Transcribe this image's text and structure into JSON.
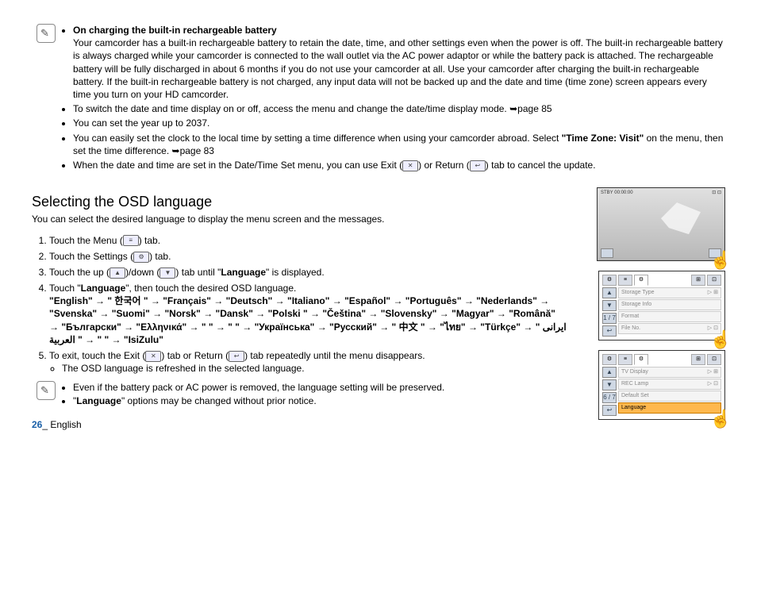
{
  "note1": {
    "h": "On charging the built-in rechargeable battery",
    "p1": "Your camcorder has a built-in rechargeable battery to retain the date, time, and other settings even when the power is off. The built-in rechargeable battery is always charged while your camcorder is connected to the wall outlet via the AC power adaptor or while the battery pack is attached. The rechargeable battery will be fully discharged in about 6 months if you do not use your camcorder at all. Use your camcorder after charging the built-in rechargeable battery. If the built-in rechargeable battery is not charged, any input data will not be backed up and the date and time (time zone) screen appears every time you turn on your HD camcorder.",
    "b2_a": "To switch the date and time display on or off, access the menu and change the date/time display mode. ",
    "b2_b": "page 85",
    "b3": "You can set the year up to 2037.",
    "b4_a": "You can easily set the clock to the local time by setting a time difference when using your camcorder abroad. Select ",
    "b4_b": "\"Time Zone: Visit\"",
    "b4_c": " on the menu, then set the time difference. ",
    "b4_d": "page 83",
    "b5_a": "When the date and time are set in the Date/Time Set menu, you can use Exit (",
    "b5_b": ") or Return (",
    "b5_c": ") tab to cancel the update."
  },
  "section": {
    "title": "Selecting the OSD language",
    "intro": "You can select the desired language to display the menu screen and the messages.",
    "s1_a": "Touch the Menu (",
    "s1_b": ") tab.",
    "s2_a": "Touch the Settings (",
    "s2_b": ") tab.",
    "s3_a": "Touch the up (",
    "s3_b": ")/down (",
    "s3_c": ") tab until \"",
    "s3_d": "Language",
    "s3_e": "\" is displayed.",
    "s4_a": "Touch \"",
    "s4_b": "Language",
    "s4_c": "\", then touch the desired OSD language.",
    "langs": "\"English\" → \" 한국어 \" → \"Français\" → \"Deutsch\" → \"Italiano\" → \"Español\" → \"Português\" → \"Nederlands\" → \"Svenska\" → \"Suomi\" → \"Norsk\" → \"Dansk\" → \"Polski \" → \"Čeština\" → \"Slovensky\" → \"Magyar\" → \"Română\" → \"Български\" → \"Ελληνικά\" → \"          \" → \"          \" → \"Українська\" → \"Русский\" → \" 中文 \" → \"ไทย\" → \"Türkçe\" → \" ايرانى \" → \" العربية \" → \"IsiZulu\"",
    "s5_a": "To exit, touch the Exit (",
    "s5_b": ") tab or Return (",
    "s5_c": ") tab repeatedly until the menu disappears.",
    "s5_sub": "The OSD language is refreshed in the selected language."
  },
  "note2": {
    "b1": "Even if the battery pack or AC power is removed, the language setting will be preserved.",
    "b2_a": "\"",
    "b2_b": "Language",
    "b2_c": "\" options may be changed without prior notice."
  },
  "icons": {
    "menu": "≡",
    "settings": "⚙",
    "exit": "✕",
    "return": "↩",
    "up": "▲",
    "down": "▼",
    "arrow": "➥"
  },
  "screens": {
    "s1_top": "STBY 00:00:00",
    "s2": {
      "pg": "1 / 7",
      "r1": "Storage Type",
      "r2": "Storage Info",
      "r3": "Format",
      "r4": "File No."
    },
    "s3": {
      "pg": "6 / 7",
      "r1": "TV Display",
      "r2": "REC Lamp",
      "r3": "Default Set",
      "r4": "Language"
    }
  },
  "footer": {
    "pg": "26",
    "sep": "_ ",
    "lang": "English"
  }
}
